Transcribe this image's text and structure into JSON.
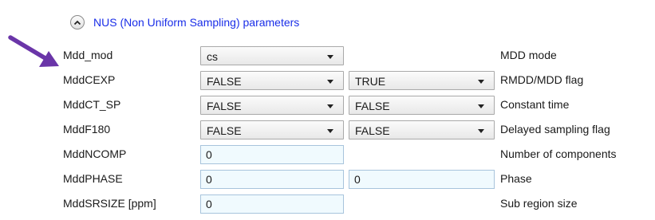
{
  "section": {
    "title": "NUS (Non Uniform Sampling) parameters"
  },
  "rows": [
    {
      "label": "Mdd_mod",
      "field1": "cs",
      "description": "MDD mode"
    },
    {
      "label": "MddCEXP",
      "field1": "FALSE",
      "field2": "TRUE",
      "description": "RMDD/MDD flag"
    },
    {
      "label": "MddCT_SP",
      "field1": "FALSE",
      "field2": "FALSE",
      "description": "Constant time"
    },
    {
      "label": "MddF180",
      "field1": "FALSE",
      "field2": "FALSE",
      "description": "Delayed sampling flag"
    },
    {
      "label": "MddNCOMP",
      "field1": "0",
      "description": "Number of components"
    },
    {
      "label": "MddPHASE",
      "field1": "0",
      "field2": "0",
      "description": "Phase"
    },
    {
      "label": "MddSRSIZE [ppm]",
      "field1": "0",
      "description": "Sub region size"
    }
  ],
  "colors": {
    "title": "#1a2ee8",
    "arrow": "#6a35a8",
    "input_bg": "#f0fafe",
    "input_border": "#a8c4dc"
  },
  "icons": {
    "collapse": "chevron-up-icon",
    "pointer": "arrow-pointer-icon"
  }
}
